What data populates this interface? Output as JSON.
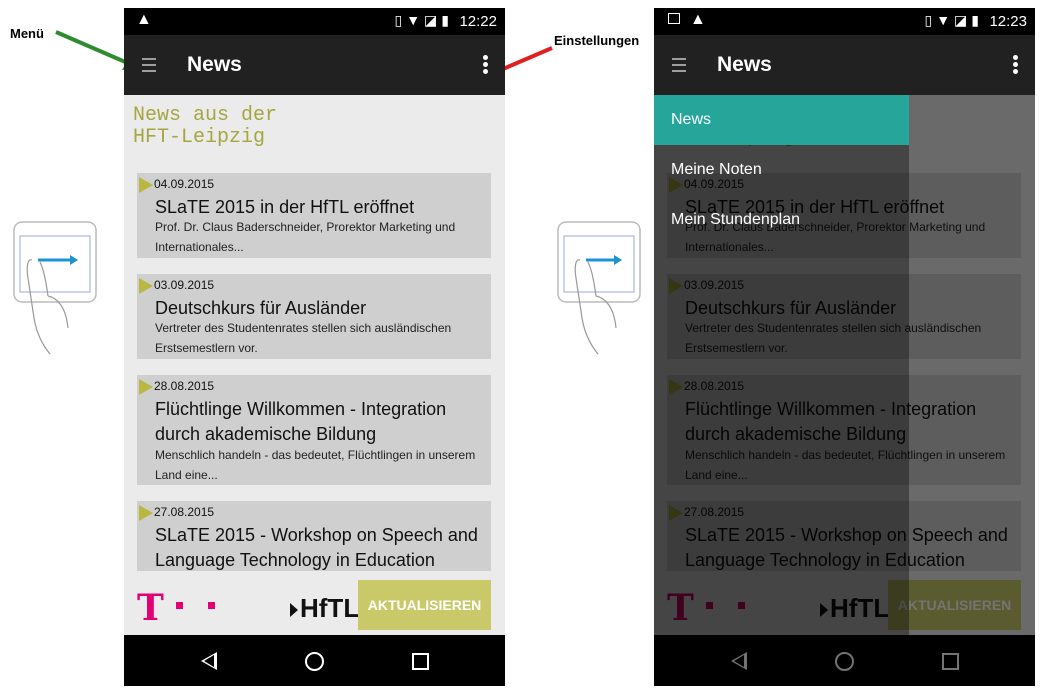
{
  "annotations": {
    "menu": "Menü",
    "settings": "Einstellungen"
  },
  "colors": {
    "accent_teal": "#26a69a",
    "telekom_magenta": "#e20074",
    "headline": "#a6a641",
    "button": "#c9c96a"
  },
  "icons": {
    "menu": "hamburger-icon",
    "overflow": "more-vert-icon",
    "warning": "warning-icon"
  },
  "phone_left": {
    "time": "12:22",
    "title": "News",
    "headline": "News aus der\nHFT-Leipzig",
    "articles": [
      {
        "date": "04.09.2015",
        "title": "SLaTE 2015 in der HfTL eröffnet",
        "teaser": "Prof. Dr. Claus Baderschneider, Prorektor Marketing und Internationales..."
      },
      {
        "date": "03.09.2015",
        "title": "Deutschkurs für Ausländer",
        "teaser": "Vertreter des Studentenrates stellen sich ausländischen Erstsemestlern vor."
      },
      {
        "date": "28.08.2015",
        "title": "Flüchtlinge Willkommen - Integration durch akademische Bildung",
        "teaser": "Menschlich handeln - das bedeutet, Flüchtlingen in unserem Land eine..."
      },
      {
        "date": "27.08.2015",
        "title": "SLaTE 2015 - Workshop on Speech and Language Technology in Education",
        "teaser": ""
      }
    ],
    "footer": {
      "t_logo": "T",
      "hftl_logo": "HfTL",
      "update_button": "AKTUALISIEREN"
    }
  },
  "phone_right": {
    "time": "12:23",
    "title": "News",
    "drawer": [
      {
        "label": "News",
        "active": true
      },
      {
        "label": "Meine Noten",
        "active": false
      },
      {
        "label": "Mein Stundenplan",
        "active": false
      }
    ]
  }
}
